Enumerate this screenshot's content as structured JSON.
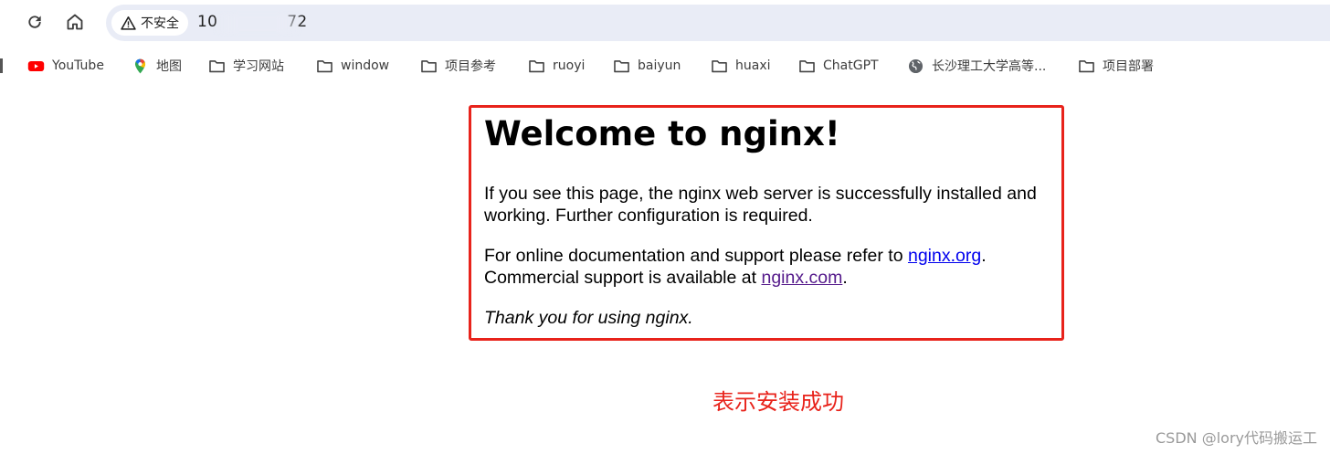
{
  "browser": {
    "security_chip": "不安全",
    "url": "10",
    "url_tail": "72"
  },
  "bookmarks": [
    {
      "label": "YouTube",
      "icon": "youtube-icon"
    },
    {
      "label": "地图",
      "icon": "maps-pin-icon"
    },
    {
      "label": "学习网站",
      "icon": "folder-icon"
    },
    {
      "label": "window",
      "icon": "folder-icon"
    },
    {
      "label": "项目参考",
      "icon": "folder-icon"
    },
    {
      "label": "ruoyi",
      "icon": "folder-icon"
    },
    {
      "label": "baiyun",
      "icon": "folder-icon"
    },
    {
      "label": "huaxi",
      "icon": "folder-icon"
    },
    {
      "label": "ChatGPT",
      "icon": "folder-icon"
    },
    {
      "label": "长沙理工大学高等...",
      "icon": "globe-icon"
    },
    {
      "label": "项目部署",
      "icon": "folder-icon"
    }
  ],
  "page": {
    "title": "Welcome to nginx!",
    "p1": "If you see this page, the nginx web server is successfully installed and working. Further configuration is required.",
    "p2_pre": "For online documentation and support please refer to ",
    "link1": "nginx.org",
    "p2_mid": ".",
    "p2_line2": "Commercial support is available at ",
    "link2": "nginx.com",
    "p2_end": ".",
    "p3": "Thank you for using nginx."
  },
  "annotation": "表示安装成功",
  "watermark": "CSDN @lory代码搬运工",
  "colors": {
    "highlight_border": "#e8231b",
    "annotation_text": "#e8231b",
    "link": "#0000ee",
    "visited_link": "#551a8b",
    "omnibox_bg": "#e9ecf6"
  }
}
